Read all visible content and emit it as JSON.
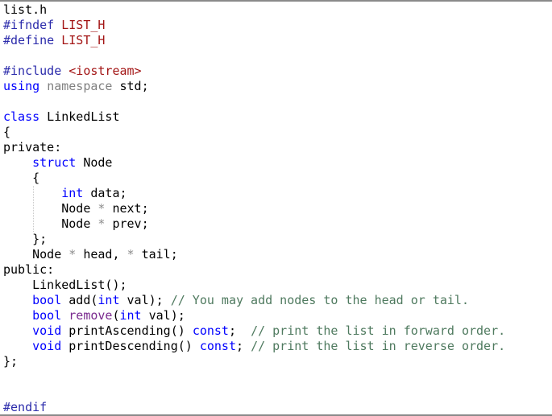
{
  "file": {
    "name": "list.h"
  },
  "colors": {
    "keyword": "#0000ff",
    "preprocessor": "#2b2bab",
    "macro": "#a31515",
    "comment": "#4f7a5f",
    "muted": "#808080",
    "text": "#000000",
    "border": "#8a8a8a"
  },
  "lines": [
    [
      {
        "t": "list.h",
        "c": ""
      }
    ],
    [
      {
        "t": "#ifndef",
        "c": "pp"
      },
      {
        "t": " ",
        "c": ""
      },
      {
        "t": "LIST_H",
        "c": "macro"
      }
    ],
    [
      {
        "t": "#define",
        "c": "pp"
      },
      {
        "t": " ",
        "c": ""
      },
      {
        "t": "LIST_H",
        "c": "macro"
      }
    ],
    [],
    [
      {
        "t": "#include",
        "c": "pp"
      },
      {
        "t": " ",
        "c": ""
      },
      {
        "t": "<iostream>",
        "c": "str"
      }
    ],
    [
      {
        "t": "using",
        "c": "kw"
      },
      {
        "t": " ",
        "c": ""
      },
      {
        "t": "namespace",
        "c": "muted"
      },
      {
        "t": " std;",
        "c": ""
      }
    ],
    [],
    [
      {
        "t": "class",
        "c": "kw"
      },
      {
        "t": " LinkedList",
        "c": ""
      }
    ],
    [
      {
        "t": "{",
        "c": ""
      }
    ],
    [
      {
        "t": "private:",
        "c": ""
      }
    ],
    [
      {
        "t": "    ",
        "c": ""
      },
      {
        "t": "struct",
        "c": "kw"
      },
      {
        "t": " Node",
        "c": ""
      }
    ],
    [
      {
        "t": "    {",
        "c": ""
      }
    ],
    [
      {
        "t": "        ",
        "c": ""
      },
      {
        "t": "int",
        "c": "kw"
      },
      {
        "t": " data;",
        "c": ""
      }
    ],
    [
      {
        "t": "        Node ",
        "c": ""
      },
      {
        "t": "*",
        "c": "op"
      },
      {
        "t": " next;",
        "c": ""
      }
    ],
    [
      {
        "t": "        Node ",
        "c": ""
      },
      {
        "t": "*",
        "c": "op"
      },
      {
        "t": " prev;",
        "c": ""
      }
    ],
    [
      {
        "t": "    };",
        "c": ""
      }
    ],
    [
      {
        "t": "    Node ",
        "c": ""
      },
      {
        "t": "*",
        "c": "op"
      },
      {
        "t": " head, ",
        "c": ""
      },
      {
        "t": "*",
        "c": "op"
      },
      {
        "t": " tail;",
        "c": ""
      }
    ],
    [
      {
        "t": "public:",
        "c": ""
      }
    ],
    [
      {
        "t": "    LinkedList();",
        "c": ""
      }
    ],
    [
      {
        "t": "    ",
        "c": ""
      },
      {
        "t": "bool",
        "c": "kw"
      },
      {
        "t": " add(",
        "c": ""
      },
      {
        "t": "int",
        "c": "kw"
      },
      {
        "t": " val); ",
        "c": ""
      },
      {
        "t": "// You may add nodes to the head or tail.",
        "c": "comment"
      }
    ],
    [
      {
        "t": "    ",
        "c": ""
      },
      {
        "t": "bool",
        "c": "kw"
      },
      {
        "t": " ",
        "c": ""
      },
      {
        "t": "remove",
        "c": "fn"
      },
      {
        "t": "(",
        "c": ""
      },
      {
        "t": "int",
        "c": "kw"
      },
      {
        "t": " val);",
        "c": ""
      }
    ],
    [
      {
        "t": "    ",
        "c": ""
      },
      {
        "t": "void",
        "c": "kw"
      },
      {
        "t": " printAscending() ",
        "c": ""
      },
      {
        "t": "const",
        "c": "kw"
      },
      {
        "t": ";  ",
        "c": ""
      },
      {
        "t": "// print the list in forward order.",
        "c": "comment"
      }
    ],
    [
      {
        "t": "    ",
        "c": ""
      },
      {
        "t": "void",
        "c": "kw"
      },
      {
        "t": " printDescending() ",
        "c": ""
      },
      {
        "t": "const",
        "c": "kw"
      },
      {
        "t": "; ",
        "c": ""
      },
      {
        "t": "// print the list in reverse order.",
        "c": "comment"
      }
    ],
    [
      {
        "t": "};",
        "c": ""
      }
    ],
    [],
    [],
    [
      {
        "t": "#endif",
        "c": "pp"
      }
    ]
  ]
}
